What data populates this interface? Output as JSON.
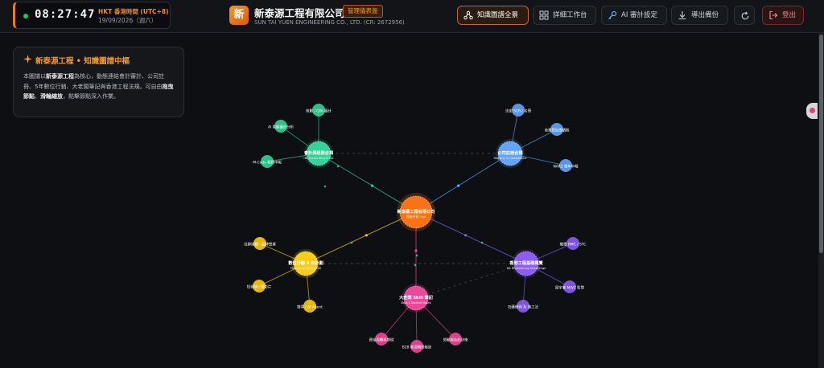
{
  "clock": {
    "time": "08:27:47",
    "zone": "HKT 香港時間 (UTC+8)",
    "date": "19/09/2026（週六）"
  },
  "brand": {
    "logo_char": "新",
    "name": "新泰源工程有限公司",
    "badge": "管理儀表盤",
    "sub": "SUN TAI YUEN ENGINEERING CO., LTD. (CR: 2672956)"
  },
  "nav": {
    "graph": "知識圖譜全景",
    "workbench": "詳細工作台",
    "ai_audit": "AI 審計設定",
    "export": "導出備份",
    "refresh_icon": "refresh-icon",
    "logout": "登出"
  },
  "info_card": {
    "title": "新泰源工程 • 知識圖譜中樞",
    "body_1": "本圖譜以",
    "body_2": "新泰源工程",
    "body_3": "為核心，動態連結會計審計、公司註冊、5年數位行銷、大老闆筆記與香港工程法規。可自由",
    "body_4": "拖曳節點",
    "body_5": "、",
    "body_6": "滑輪縮放",
    "body_7": "，點擊節點深入作業。"
  },
  "colors": {
    "accent": "#f07b1a",
    "hub": "#f97316",
    "accounting": "#34d399",
    "compliance": "#60a5fa",
    "marketing": "#facc15",
    "engineering": "#8b5cf6",
    "notes": "#ec4899"
  },
  "graph": {
    "hub": {
      "name": "新泰源工程有限公司",
      "sub": "智能中樞 Hub"
    },
    "categories": [
      {
        "key": "accounting",
        "name": "會計與稅務合規",
        "sub": "HK Accounting & Tax",
        "children": [
          "核數 / CPA 審計",
          "AI 智能審計分析",
          "M-Code 稅務申報"
        ]
      },
      {
        "key": "compliance",
        "name": "公司註冊合規",
        "sub": "Registry & Compliance",
        "children": [
          "法定 SCR / 名冊",
          "商業登記證續期",
          "NAR1 週年申報"
        ]
      },
      {
        "key": "marketing",
        "name": "數位行銷 5 年計劃",
        "sub": "Marketing 2026-2030",
        "children": [
          "社群媒體 · 品牌營運",
          "短視頻 / 短影片",
          "搜尋 / AI Agent"
        ]
      },
      {
        "key": "engineering",
        "name": "香港工程基礎概覽",
        "sub": "HK Engineering Knowledge",
        "children": [
          "機電 RMC / STC",
          "屋宇署 MWC 監管",
          "石礦條例 及 施工法"
        ]
      },
      {
        "key": "notes",
        "name": "大老闆 Skill 筆記",
        "sub": "Boss's Tactical Notes",
        "children": [
          "資金周轉與節稅",
          "B2B 客源開發秘訣",
          "勞動與合約決策"
        ]
      }
    ]
  }
}
